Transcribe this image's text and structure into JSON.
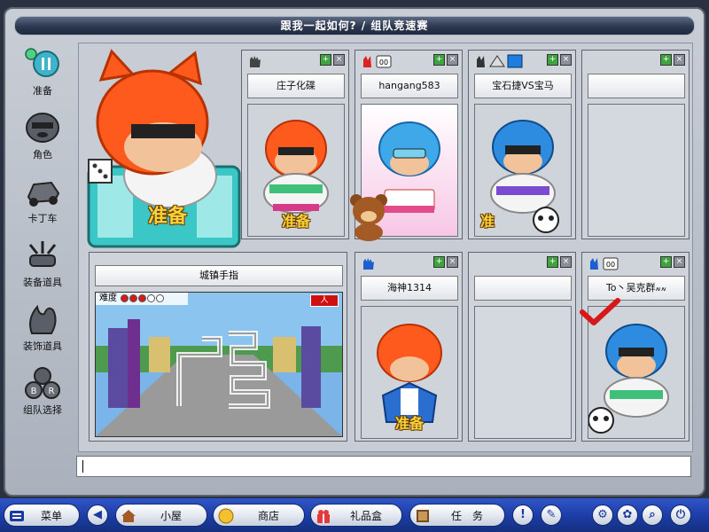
{
  "window": {
    "title": "跟我一起如何? / 组队竞速赛"
  },
  "sidebar": {
    "items": [
      {
        "label": "准备",
        "icon": "pause-icon"
      },
      {
        "label": "角色",
        "icon": "character-icon"
      },
      {
        "label": "卡丁车",
        "icon": "kart-icon"
      },
      {
        "label": "装备道具",
        "icon": "equipment-icon"
      },
      {
        "label": "装饰道具",
        "icon": "decoration-icon"
      },
      {
        "label": "组队选择",
        "icon": "team-select-icon"
      }
    ]
  },
  "hero": {
    "ready_label": "准备"
  },
  "slots": [
    {
      "name": "庄子化碟",
      "ready": "准备"
    },
    {
      "name": "hangang583",
      "ready": ""
    },
    {
      "name": "宝石捷VS宝马",
      "ready": "准"
    },
    {
      "name": "",
      "ready": ""
    },
    {
      "name": "海神1314",
      "ready": "准备"
    },
    {
      "name": "",
      "ready": ""
    },
    {
      "name": "To丶吴克群៷៷",
      "ready": ""
    }
  ],
  "map": {
    "name": "城镇手指",
    "difficulty_label": "难度",
    "difficulty_filled": 3,
    "difficulty_total": 5,
    "people_label": "人"
  },
  "chat": {
    "value": ""
  },
  "taskbar": {
    "menu_label": "菜单",
    "room_label": "小屋",
    "shop_label": "商店",
    "gift_label": "礼品盒",
    "task_label": "任　务"
  },
  "colors": {
    "titlebar": "#2c3850",
    "taskbar": "#1a3aa0",
    "ready": "#f6d33a"
  }
}
